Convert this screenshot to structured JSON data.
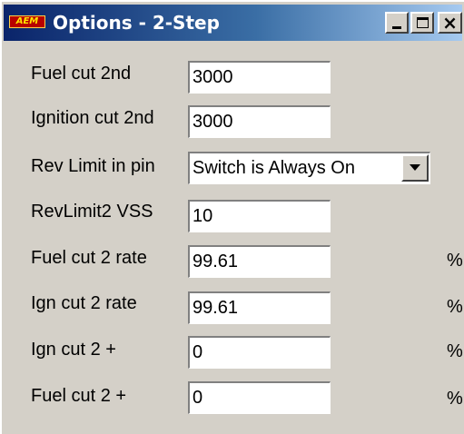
{
  "window": {
    "logo_text": "AEM",
    "title": "Options - 2-Step"
  },
  "fields": [
    {
      "label": "Fuel cut 2nd",
      "value": "3000",
      "unit": ""
    },
    {
      "label": "Ignition cut 2nd",
      "value": "3000",
      "unit": ""
    },
    {
      "label": "Rev Limit in pin",
      "value": "Switch is Always On",
      "unit": ""
    },
    {
      "label": "RevLimit2 VSS",
      "value": "10",
      "unit": ""
    },
    {
      "label": "Fuel cut 2 rate",
      "value": "99.61",
      "unit": "%"
    },
    {
      "label": "Ign cut 2 rate",
      "value": "99.61",
      "unit": "%"
    },
    {
      "label": "Ign cut 2 +",
      "value": "0",
      "unit": "%"
    },
    {
      "label": "Fuel cut 2 +",
      "value": "0",
      "unit": "%"
    }
  ],
  "icons": {
    "minimize": "minimize-icon",
    "maximize": "maximize-icon",
    "close": "close-icon",
    "dropdown": "chevron-down-icon"
  }
}
